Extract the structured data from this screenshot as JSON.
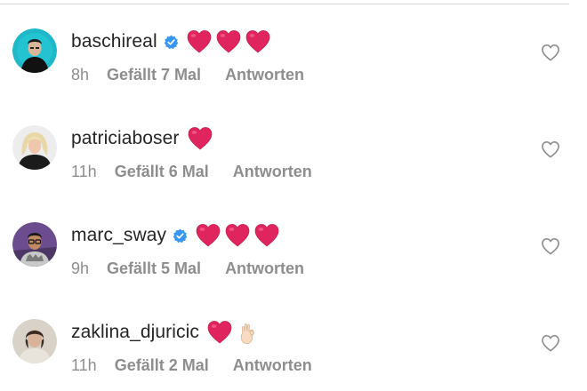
{
  "comments": [
    {
      "username": "baschireal",
      "verified": true,
      "emoji": [
        "red-heart",
        "red-heart",
        "red-heart"
      ],
      "time": "8h",
      "likes": "Gefällt 7 Mal",
      "reply": "Antworten"
    },
    {
      "username": "patriciaboser",
      "verified": false,
      "emoji": [
        "red-heart"
      ],
      "time": "11h",
      "likes": "Gefällt 6 Mal",
      "reply": "Antworten"
    },
    {
      "username": "marc_sway",
      "verified": true,
      "emoji": [
        "red-heart",
        "red-heart",
        "red-heart"
      ],
      "time": "9h",
      "likes": "Gefällt 5 Mal",
      "reply": "Antworten"
    },
    {
      "username": "zaklina_djuricic",
      "verified": false,
      "emoji": [
        "red-heart",
        "ok-hand"
      ],
      "time": "11h",
      "likes": "Gefällt 2 Mal",
      "reply": "Antworten"
    }
  ],
  "colors": {
    "text": "#262626",
    "meta": "#8e8e8e",
    "verified": "#3897f0",
    "heart": "#e0245e"
  }
}
